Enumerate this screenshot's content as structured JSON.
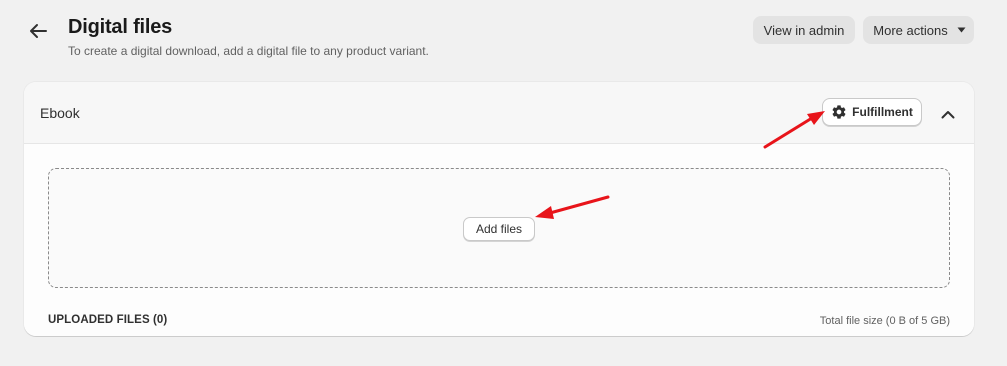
{
  "header": {
    "back_icon": "arrow-left-icon",
    "title": "Digital files",
    "subtitle": "To create a digital download, add a digital file to any product variant.",
    "view_in_admin": "View in admin",
    "more_actions": "More actions",
    "more_actions_icon": "caret-down-icon"
  },
  "card": {
    "title": "Ebook",
    "fulfillment_label": "Fulfillment",
    "fulfillment_icon": "gear-icon",
    "collapse_icon": "chevron-up-icon",
    "add_files_label": "Add files",
    "uploaded_files_label": "UPLOADED FILES (0)",
    "total_size_label": "Total file size (0 B of 5 GB)"
  },
  "annotations": {
    "arrow_color": "#e8141a"
  },
  "colors": {
    "page_bg": "#f1f1f1",
    "card_bg": "#ffffff",
    "secondary_button_bg": "#e3e3e3"
  }
}
